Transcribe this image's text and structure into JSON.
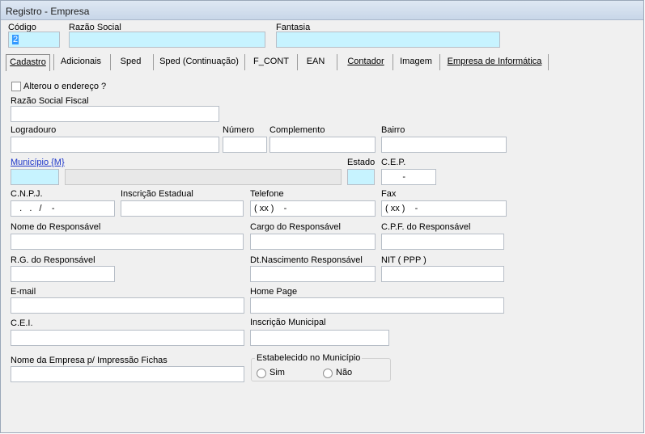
{
  "window": {
    "title": "Registro - Empresa"
  },
  "header": {
    "codigo_label": "Código",
    "codigo_value": "2",
    "razao_social_label": "Razão Social",
    "razao_social_value": "",
    "fantasia_label": "Fantasia",
    "fantasia_value": ""
  },
  "tabs": [
    {
      "label": "Cadastro",
      "active": true
    },
    {
      "label": "Adicionais"
    },
    {
      "label": "Sped"
    },
    {
      "label": "Sped (Continuação)"
    },
    {
      "label": "F_CONT"
    },
    {
      "label": "EAN"
    },
    {
      "label": "Contador"
    },
    {
      "label": "Imagem"
    },
    {
      "label": "Empresa de Informática"
    }
  ],
  "form": {
    "alterou_endereco_label": "Alterou o endereço ?",
    "alterou_endereco_checked": false,
    "razao_social_fiscal_label": "Razão Social Fiscal",
    "logradouro_label": "Logradouro",
    "numero_label": "Número",
    "complemento_label": "Complemento",
    "bairro_label": "Bairro",
    "municipio_label": "Município {M}",
    "estado_label": "Estado",
    "cep_label": "C.E.P.",
    "cep_mask": "       -",
    "cnpj_label": "C.N.P.J.",
    "cnpj_mask": "  .   .   /    -",
    "inscricao_estadual_label": "Inscrição Estadual",
    "telefone_label": "Telefone",
    "telefone_mask": "( xx )    -",
    "fax_label": "Fax",
    "fax_mask": "( xx )    -",
    "nome_responsavel_label": "Nome do Responsável",
    "cargo_responsavel_label": "Cargo do Responsável",
    "cpf_responsavel_label": "C.P.F. do Responsável",
    "rg_responsavel_label": "R.G. do Responsável",
    "dt_nascimento_label": "Dt.Nascimento Responsável",
    "nit_label": "NIT ( PPP )",
    "email_label": "E-mail",
    "home_page_label": "Home Page",
    "cei_label": "C.E.I.",
    "inscricao_municipal_label": "Inscrição Municipal",
    "nome_empresa_fichas_label": "Nome da Empresa p/ Impressão Fichas",
    "estabelecido_label": "Estabelecido no Município",
    "sim_label": "Sim",
    "nao_label": "Não"
  },
  "colors": {
    "required_field": "#c7f3ff",
    "link": "#1b35c9",
    "selection": "#3399ff"
  }
}
